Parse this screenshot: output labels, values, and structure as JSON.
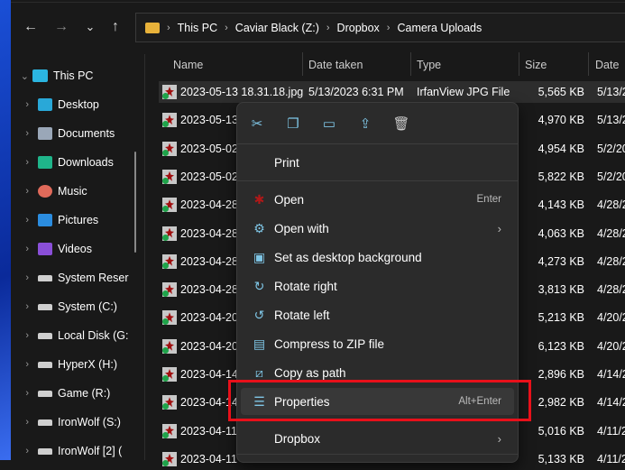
{
  "nav": {
    "back": "←",
    "forward": "→",
    "recent": "⌄",
    "up": "↑"
  },
  "breadcrumb": [
    "This PC",
    "Caviar Black (Z:)",
    "Dropbox",
    "Camera Uploads"
  ],
  "sidebar": {
    "root": "This PC",
    "items": [
      {
        "label": "Desktop",
        "icon": "desktop-icon",
        "color": "#29a8d8"
      },
      {
        "label": "Documents",
        "icon": "documents-icon",
        "color": "#9aa7b8"
      },
      {
        "label": "Downloads",
        "icon": "downloads-icon",
        "color": "#1fb58a"
      },
      {
        "label": "Music",
        "icon": "music-icon",
        "color": "#e06a5a"
      },
      {
        "label": "Pictures",
        "icon": "pictures-icon",
        "color": "#2b8de0"
      },
      {
        "label": "Videos",
        "icon": "videos-icon",
        "color": "#8a4fd8"
      },
      {
        "label": "System Reser",
        "icon": "drive-icon",
        "color": "#cfcfcf"
      },
      {
        "label": "System (C:)",
        "icon": "system-drive-icon",
        "color": "#cfcfcf"
      },
      {
        "label": "Local Disk (G:",
        "icon": "drive-icon",
        "color": "#cfcfcf"
      },
      {
        "label": "HyperX (H:)",
        "icon": "drive-icon",
        "color": "#cfcfcf"
      },
      {
        "label": "Game (R:)",
        "icon": "drive-icon",
        "color": "#cfcfcf"
      },
      {
        "label": "IronWolf (S:)",
        "icon": "drive-icon",
        "color": "#cfcfcf"
      },
      {
        "label": "IronWolf [2] (",
        "icon": "drive-icon",
        "color": "#cfcfcf"
      }
    ]
  },
  "columns": {
    "name": "Name",
    "date_taken": "Date taken",
    "type": "Type",
    "size": "Size",
    "date": "Date"
  },
  "files": [
    {
      "name": "2023-05-13 18.31.18.jpg",
      "date_taken": "5/13/2023 6:31 PM",
      "type": "IrfanView JPG File",
      "size": "5,565 KB",
      "date": "5/13/2"
    },
    {
      "name": "2023-05-13",
      "size": "4,970 KB",
      "date": "5/13/2"
    },
    {
      "name": "2023-05-02",
      "size": "4,954 KB",
      "date": "5/2/20"
    },
    {
      "name": "2023-05-02",
      "size": "5,822 KB",
      "date": "5/2/20"
    },
    {
      "name": "2023-04-28",
      "size": "4,143 KB",
      "date": "4/28/2"
    },
    {
      "name": "2023-04-28",
      "size": "4,063 KB",
      "date": "4/28/2"
    },
    {
      "name": "2023-04-28",
      "size": "4,273 KB",
      "date": "4/28/2"
    },
    {
      "name": "2023-04-28",
      "size": "3,813 KB",
      "date": "4/28/2"
    },
    {
      "name": "2023-04-20",
      "size": "5,213 KB",
      "date": "4/20/2"
    },
    {
      "name": "2023-04-20",
      "size": "6,123 KB",
      "date": "4/20/2"
    },
    {
      "name": "2023-04-14",
      "size": "2,896 KB",
      "date": "4/14/2"
    },
    {
      "name": "2023-04-14",
      "size": "2,982 KB",
      "date": "4/14/2"
    },
    {
      "name": "2023-04-11",
      "size": "5,016 KB",
      "date": "4/11/2"
    },
    {
      "name": "2023-04-11",
      "size": "5,133 KB",
      "date": "4/11/2"
    }
  ],
  "context_menu": {
    "quick_actions": [
      {
        "name": "cut",
        "icon": "✂"
      },
      {
        "name": "copy",
        "icon": "❐"
      },
      {
        "name": "rename",
        "icon": "▭"
      },
      {
        "name": "share",
        "icon": "⇪"
      },
      {
        "name": "delete",
        "icon": "🗑"
      }
    ],
    "print": "Print",
    "items": [
      {
        "label": "Open",
        "accel": "Enter",
        "icon": "irfanview-icon"
      },
      {
        "label": "Open with",
        "submenu": "›",
        "icon": "open-with-icon"
      },
      {
        "label": "Set as desktop background",
        "icon": "desktop-background-icon"
      },
      {
        "label": "Rotate right",
        "icon": "rotate-right-icon"
      },
      {
        "label": "Rotate left",
        "icon": "rotate-left-icon"
      },
      {
        "label": "Compress to ZIP file",
        "icon": "zip-icon"
      },
      {
        "label": "Copy as path",
        "icon": "copy-path-icon"
      },
      {
        "label": "Properties",
        "accel": "Alt+Enter",
        "icon": "properties-icon",
        "highlighted": true
      }
    ],
    "dropbox": {
      "label": "Dropbox",
      "submenu": "›"
    }
  },
  "annotation_color": "#e8101a"
}
